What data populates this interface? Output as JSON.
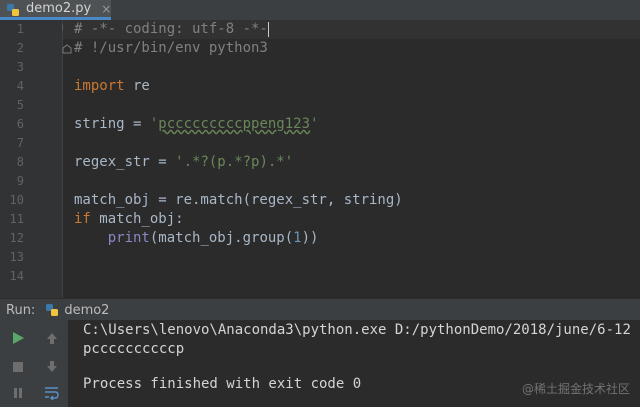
{
  "editor_tab": {
    "filename": "demo2.py",
    "close_glyph": "×"
  },
  "editor": {
    "line_numbers": [
      "1",
      "2",
      "3",
      "4",
      "5",
      "6",
      "7",
      "8",
      "9",
      "10",
      "11",
      "12",
      "13",
      "14"
    ],
    "code": {
      "l1": "# -*- coding: utf-8 -*-",
      "l2": "# !/usr/bin/env python3",
      "l4_kw": "import",
      "l4_rest": " re",
      "l6_a": "string = ",
      "l6_q1": "'",
      "l6_str": "pcccccccccppeng123",
      "l6_q2": "'",
      "l8_a": "regex_str = ",
      "l8_str": "'.*?(p.*?p).*'",
      "l10": "match_obj = re.match(regex_str, string)",
      "l11_kw": "if",
      "l11_rest": " match_obj:",
      "l12_indent": "    ",
      "l12_fn": "print",
      "l12_a": "(match_obj.group(",
      "l12_num": "1",
      "l12_b": "))"
    }
  },
  "run_panel": {
    "title": "Run:",
    "tab_label": "demo2",
    "icons": [
      "run-icon",
      "up-arrow-icon",
      "stop-icon",
      "down-arrow-icon",
      "pause-icon",
      "soft-wrap-icon"
    ]
  },
  "console": {
    "command": "C:\\Users\\lenovo\\Anaconda3\\python.exe D:/pythonDemo/2018/june/6-12",
    "output": "pccccccccccp",
    "exit": "Process finished with exit code 0"
  },
  "watermark": "@稀土掘金技术社区",
  "colors": {
    "background": "#2b2b2b",
    "gutter": "#313335",
    "keyword": "#cc7832",
    "string": "#6a8759",
    "comment": "#808080",
    "number": "#6897bb",
    "builtin": "#8888c6",
    "run_green": "#59a869"
  }
}
